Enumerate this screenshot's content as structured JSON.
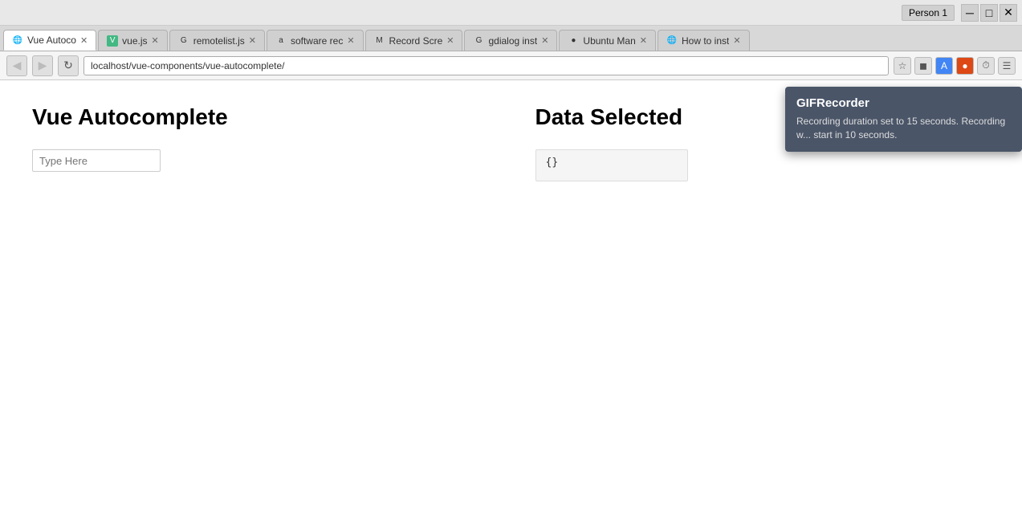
{
  "titlebar": {
    "user_label": "Person 1",
    "minimize_btn": "─",
    "restore_btn": "□",
    "close_btn": "✕"
  },
  "tabs": [
    {
      "id": "tab-vue-auto",
      "icon_color": "#aaa",
      "icon_char": "🌐",
      "label": "Vue Autoco",
      "active": true
    },
    {
      "id": "tab-vuejs",
      "icon_color": "#42b883",
      "icon_char": "V",
      "label": "vue.js",
      "active": false
    },
    {
      "id": "tab-remotelist",
      "icon_color": "#4285f4",
      "icon_char": "G",
      "label": "remotelist.js",
      "active": false
    },
    {
      "id": "tab-software",
      "icon_color": "#e05d44",
      "icon_char": "a",
      "label": "software rec",
      "active": false
    },
    {
      "id": "tab-record",
      "icon_color": "#555",
      "icon_char": "M",
      "label": "Record Scre",
      "active": false
    },
    {
      "id": "tab-gdialog",
      "icon_color": "#4285f4",
      "icon_char": "G",
      "label": "gdialog inst",
      "active": false
    },
    {
      "id": "tab-ubuntu",
      "icon_color": "#dd4814",
      "icon_char": "🔴",
      "label": "Ubuntu Man",
      "active": false
    },
    {
      "id": "tab-howto",
      "icon_color": "#888",
      "icon_char": "🌐",
      "label": "How to inst",
      "active": false
    }
  ],
  "navbar": {
    "back_btn": "◀",
    "forward_btn": "▶",
    "reload_btn": "↻",
    "address": "localhost/vue-components/vue-autocomplete/",
    "star_icon": "☆",
    "ext1_icon": "◼",
    "ext2_icon": "◼",
    "ext3_icon": "◼",
    "ext4_icon": "⏱",
    "menu_icon": "☰"
  },
  "page": {
    "autocomplete_section": {
      "title": "Vue Autocomplete",
      "input_placeholder": "Type Here"
    },
    "data_section": {
      "title": "Data Selected",
      "data_value": "{}"
    }
  },
  "gif_recorder": {
    "title": "GIFRecorder",
    "message": "Recording duration set to 15 seconds. Recording w... start in 10 seconds."
  }
}
